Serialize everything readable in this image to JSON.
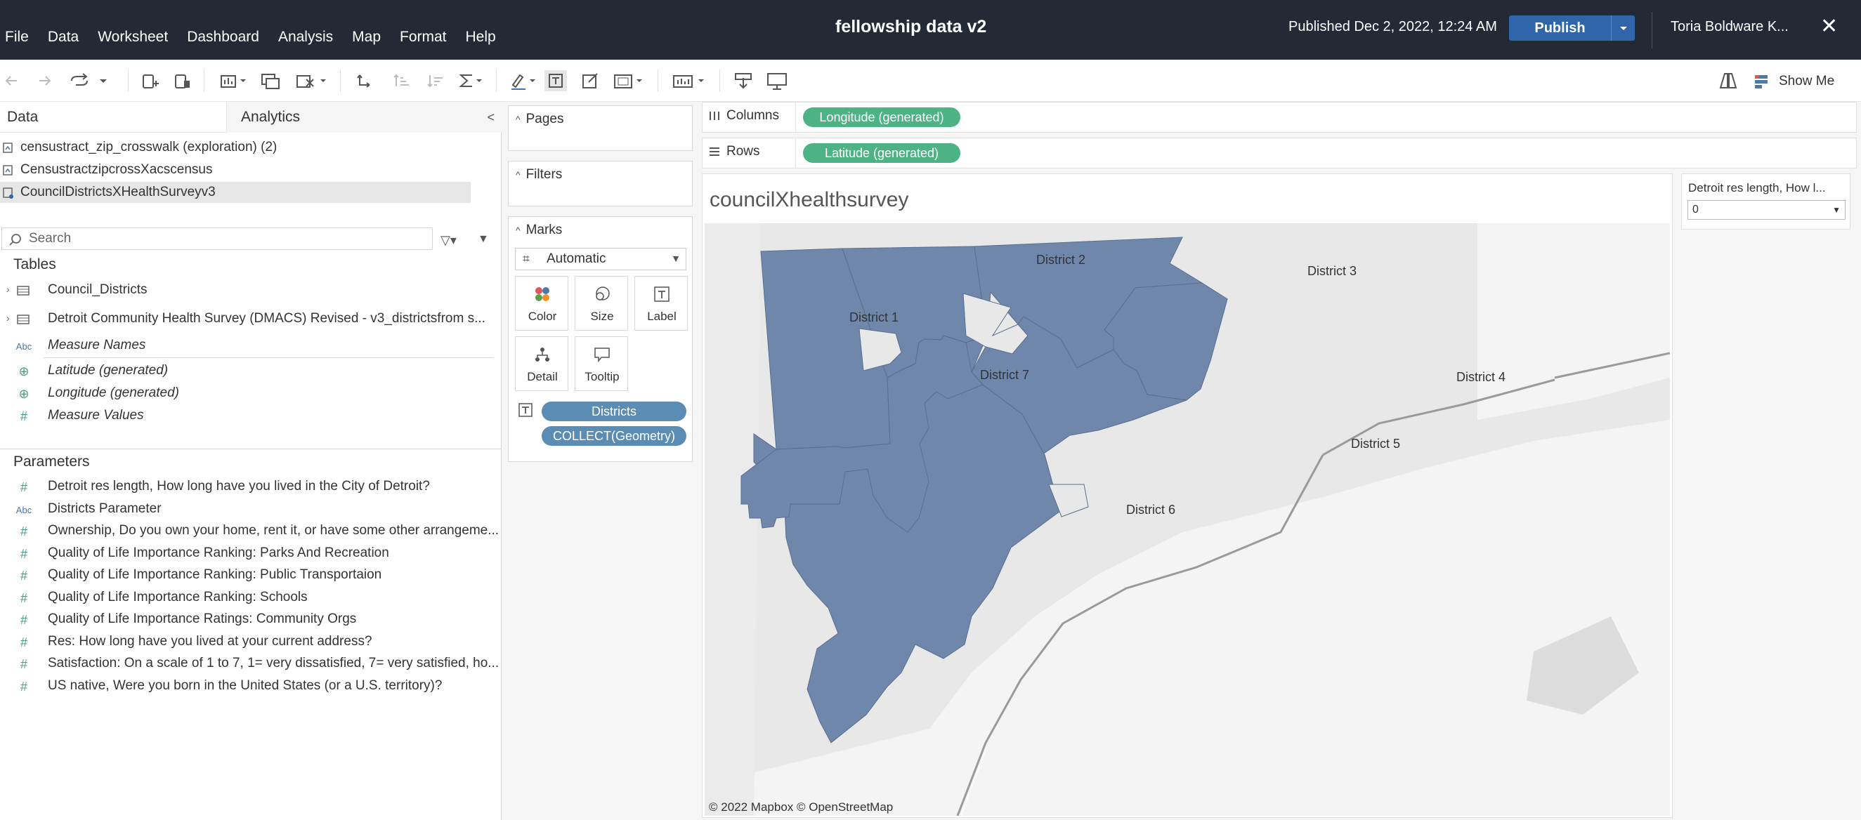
{
  "menu": [
    "File",
    "Data",
    "Worksheet",
    "Dashboard",
    "Analysis",
    "Map",
    "Format",
    "Help"
  ],
  "workbook_title": "fellowship data v2",
  "published": "Published Dec 2, 2022, 12:24 AM",
  "publish_label": "Publish",
  "user": "Toria Boldware K...",
  "show_me": "Show Me",
  "left_tabs": {
    "data": "Data",
    "analytics": "Analytics"
  },
  "datasources": [
    "censustract_zip_crosswalk (exploration) (2)",
    "CensustractzipcrossXacscensus",
    "CouncilDistrictsXHealthSurveyv3"
  ],
  "search_placeholder": "Search",
  "tables_heading": "Tables",
  "tables": [
    "Council_Districts",
    "Detroit Community Health Survey (DMACS) Revised - v3_districtsfrom s..."
  ],
  "fields": [
    {
      "type": "Abc",
      "name": "Measure Names"
    },
    {
      "type": "geo",
      "name": "Latitude (generated)"
    },
    {
      "type": "geo",
      "name": "Longitude (generated)"
    },
    {
      "type": "#",
      "name": "Measure Values"
    }
  ],
  "parameters_heading": "Parameters",
  "parameters": [
    {
      "type": "#",
      "name": "Detroit res length, How long have you lived in the City of Detroit?"
    },
    {
      "type": "Abc",
      "name": "Districts Parameter"
    },
    {
      "type": "#",
      "name": "Ownership, Do you own your home, rent it, or have some other arrangeme..."
    },
    {
      "type": "#",
      "name": "Quality of Life Importance Ranking: Parks And Recreation"
    },
    {
      "type": "#",
      "name": "Quality of Life Importance Ranking: Public Transportaion"
    },
    {
      "type": "#",
      "name": "Quality of Life Importance Ranking: Schools"
    },
    {
      "type": "#",
      "name": "Quality of Life Importance Ratings: Community Orgs"
    },
    {
      "type": "#",
      "name": "Res: How long have you lived at your current address?"
    },
    {
      "type": "#",
      "name": "Satisfaction: On a scale of 1 to 7, 1= very dissatisfied, 7= very satisfied, ho..."
    },
    {
      "type": "#",
      "name": "US native, Were you born in the United States (or a U.S. territory)?"
    }
  ],
  "cards": {
    "pages": "Pages",
    "filters": "Filters",
    "marks": "Marks"
  },
  "mark_type": "Automatic",
  "mark_buttons": [
    "Color",
    "Size",
    "Label",
    "Detail",
    "Tooltip"
  ],
  "mark_pills": [
    "Districts",
    "COLLECT(Geometry)"
  ],
  "columns_label": "Columns",
  "rows_label": "Rows",
  "columns_pill": "Longitude (generated)",
  "rows_pill": "Latitude (generated)",
  "sheet_title": "councilXhealthsurvey",
  "districts": [
    "District 1",
    "District 2",
    "District 3",
    "District 4",
    "District 5",
    "District 6",
    "District 7"
  ],
  "map_credit": "© 2022 Mapbox  © OpenStreetMap",
  "parameter_control": {
    "title": "Detroit res length, How l...",
    "value": "0"
  },
  "colors": {
    "district_fill": "#7087ac",
    "pill_blue": "#5b8db4",
    "pill_green": "#4db284",
    "publish": "#2e66a9",
    "topbar": "#232935"
  }
}
